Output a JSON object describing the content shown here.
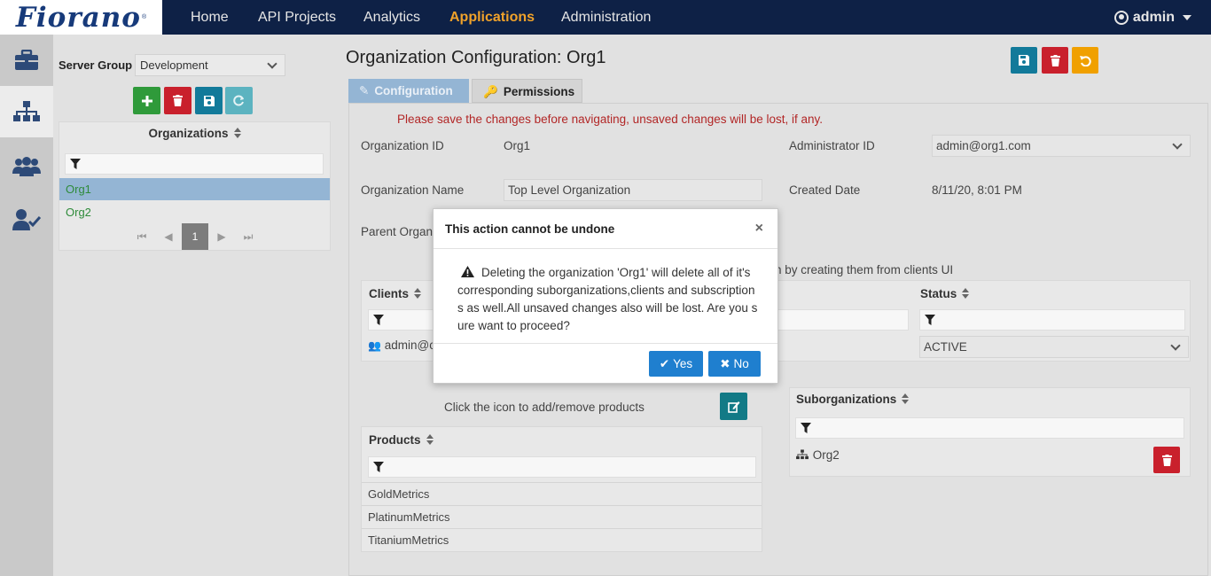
{
  "app": {
    "logo_text": "Fiorano",
    "nav": [
      "Home",
      "API Projects",
      "Analytics",
      "Applications",
      "Administration"
    ],
    "active_nav": "Applications",
    "user": "admin"
  },
  "left_panel": {
    "server_group_label": "Server Group",
    "server_group_value": "Development",
    "organizations_header": "Organizations",
    "organizations": [
      "Org1",
      "Org2"
    ],
    "selected_org": "Org1",
    "current_page": "1"
  },
  "main": {
    "title": "Organization Configuration: Org1",
    "tabs": [
      "Configuration",
      "Permissions"
    ],
    "active_tab": "Configuration",
    "warning": "Please save the changes before navigating, unsaved changes will be lost, if any.",
    "fields": {
      "org_id_label": "Organization ID",
      "org_id_value": "Org1",
      "admin_id_label": "Administrator ID",
      "admin_id_value": "admin@org1.com",
      "org_name_label": "Organization Name",
      "org_name_value": "Top Level Organization",
      "created_label": "Created Date",
      "created_value": "8/11/20, 8:01 PM",
      "parent_label": "Parent Organ"
    },
    "clients_note": "n by creating them from clients UI",
    "clients": {
      "col_clients": "Clients",
      "col_status": "Status",
      "row_client": "admin@c",
      "row_status": "ACTIVE"
    },
    "products_note": "Click the icon to add/remove products",
    "products": {
      "header": "Products",
      "rows": [
        "GoldMetrics",
        "PlatinumMetrics",
        "TitaniumMetrics"
      ]
    },
    "suborgs": {
      "header": "Suborganizations",
      "rows": [
        "Org2"
      ]
    }
  },
  "modal": {
    "title": "This action cannot be undone",
    "close": "×",
    "message": "Deleting the organization 'Org1' will delete all of it's corresponding suborganizations,clients and subscriptions as well.All unsaved changes also will be lost. Are you sure want to proceed?",
    "yes_label": "Yes",
    "no_label": "No"
  },
  "colors": {
    "nav_bg": "#0e2146",
    "active_nav": "#f0a22a",
    "primary": "#1f7fcf",
    "danger": "#c9202c",
    "success": "#2f9a3a",
    "teal": "#127a86",
    "warning": "#f0a000"
  }
}
